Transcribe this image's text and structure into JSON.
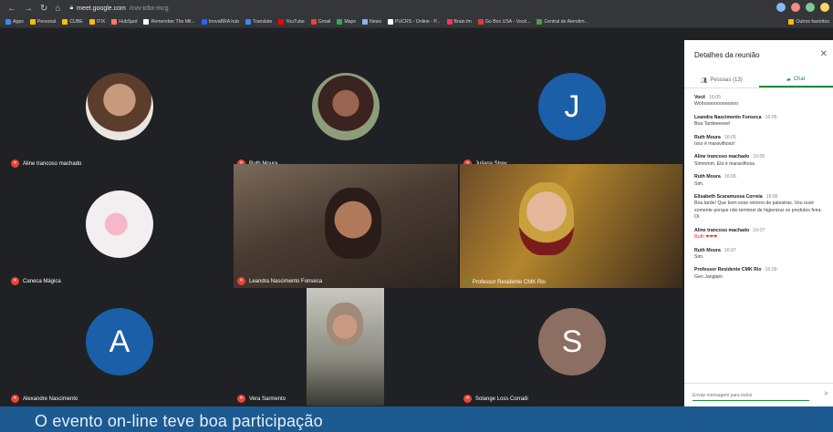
{
  "browser": {
    "url_host": "meet.google.com",
    "url_path": "/cvv-icbx-mcg",
    "bookmarks": [
      "Apps",
      "Personal",
      "CUBE",
      "ITIX",
      "HubSpot",
      "Remember The Mil...",
      "InovaBRA hub",
      "Translate",
      "YouTube",
      "Gmail",
      "Maps",
      "News",
      "PUCRS - Online - P...",
      "Brain.fm",
      "Go Box USA - Você...",
      "Central de Atendim..."
    ],
    "bookmarks_right": "Outros favoritos"
  },
  "tiles": [
    {
      "name": "Aline trancoso machado",
      "mic": "off",
      "avatar_type": "photo",
      "avatar_color": "#7a5a46"
    },
    {
      "name": "Ruth Moura",
      "mic": "off",
      "avatar_type": "photo",
      "avatar_color": "#5a3a2e"
    },
    {
      "name": "Juliana Strey",
      "mic": "off",
      "avatar_type": "letter",
      "avatar_letter": "J",
      "avatar_color": "#1a5fa8"
    },
    {
      "name": "Caneca Mágica",
      "mic": "off",
      "avatar_type": "photo",
      "avatar_color": "#f3eff0"
    },
    {
      "name": "Leandra Nascimento Fonseca",
      "mic": "off",
      "avatar_type": "video"
    },
    {
      "name": "Professor Residente CMK Rio",
      "mic": "on",
      "avatar_type": "video"
    },
    {
      "name": "Alexandre Nascimento",
      "mic": "off",
      "avatar_type": "letter",
      "avatar_letter": "A",
      "avatar_color": "#1a5fa8"
    },
    {
      "name": "Vera Sarmento",
      "mic": "off",
      "avatar_type": "video"
    },
    {
      "name": "Solange Loss Corradi",
      "mic": "off",
      "avatar_type": "letter",
      "avatar_letter": "S",
      "avatar_color": "#8d6e63"
    }
  ],
  "panel": {
    "title": "Detalhes da reunião",
    "tab_people": "Pessoas (13)",
    "tab_chat": "Chat",
    "messages": [
      {
        "sender": "Você",
        "time": "16:05",
        "text": "Wohooooooooooooo"
      },
      {
        "sender": "Leandra Nascimento Fonseca",
        "time": "16:05",
        "text": "Boa Tardeeeeee!"
      },
      {
        "sender": "Ruth Moura",
        "time": "16:05",
        "text": "Isso é maravilhoso!"
      },
      {
        "sender": "Aline trancoso machado",
        "time": "16:05",
        "text": "Simmmm. Ela é maravilhosa"
      },
      {
        "sender": "Ruth Moura",
        "time": "16:06",
        "text": "Sim."
      },
      {
        "sender": "Elisabeth Scaramussa Correia",
        "time": "16:06",
        "text": "Boa tarde! Que bom esse retorno de palestras. Vou ouvir somente porque não terminei de higienizar os produtos feira. Oi"
      },
      {
        "sender": "Aline trancoso machado",
        "time": "16:07",
        "text": "Ruth ❤❤❤"
      },
      {
        "sender": "Ruth Moura",
        "time": "16:07",
        "text": "Sim."
      },
      {
        "sender": "Professor Residente CMK Rio",
        "time": "16:09",
        "text": "Gen Janglam"
      }
    ],
    "composer_placeholder": "Enviar mensagem para todos"
  },
  "caption": "O evento on-line teve boa participação"
}
